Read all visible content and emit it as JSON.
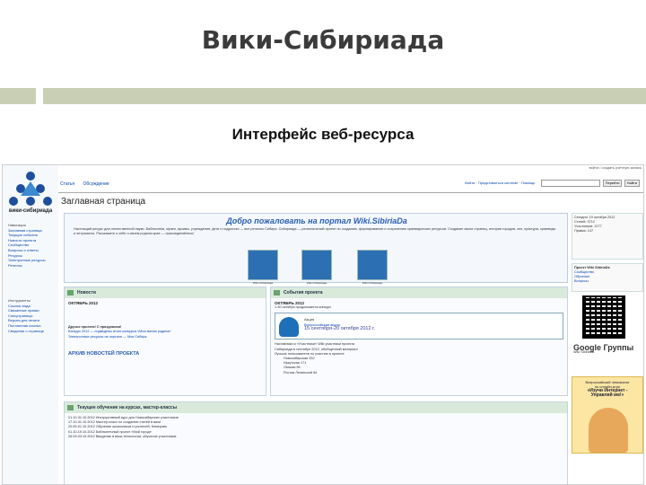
{
  "slide": {
    "title": "Вики-Сибириада",
    "subtitle": "Интерфейс веб-ресурса"
  },
  "colors": {
    "accent_bar": "#c9cfb4",
    "link": "#0645ad",
    "panel_head": "#d9eadb",
    "welcome_title": "#2a5db0"
  },
  "wiki": {
    "sidebar": {
      "logo_text": "вики-сибириада",
      "nav_head": "Навигация",
      "nav_items": [
        "Заглавная страница",
        "Текущие события",
        "Новости проекта",
        "Сообщество",
        "Вопросы и ответы",
        "Ресурсы",
        "Электронные ресурсы",
        "Регионы"
      ],
      "tools_head": "Инструменты",
      "tool_items": [
        "Ссылки сюда",
        "Связанные правки",
        "Спецстраницы",
        "Версия для печати",
        "Постоянная ссылка",
        "Сведения о странице"
      ]
    },
    "tabs": [
      "Статья",
      "Обсуждение"
    ],
    "search": {
      "links": [
        "Войти",
        "Представиться системе",
        "Помощь"
      ],
      "buttons": [
        "Перейти",
        "Найти"
      ]
    },
    "page_heading": "Заглавная страница",
    "welcome": {
      "title": "Добро пожаловать на портал Wiki.SibiriaDa",
      "text": "Настоящий ресурс для отечественной науки. Библиотеки, музеи, архивы, учреждения, дети и подростки — все регионы Сибири. Сибириада — региональный проект по созданию, формированию и сохранению краеведческих ресурсов. Создание своих страниц, истории городов, сел, культуры, краеведы и энтузиасты. Расскажите о себе и своем родном крае — присоединяйтесь!",
      "emblems": [
        "Wiki Сибириада",
        "Wiki Сибириада",
        "Wiki Сибириада"
      ]
    },
    "news_panel": {
      "head": "Новости",
      "month": "ОКТЯБРЬ 2012",
      "items": [
        "Друзья проекта! С праздником!",
        "Конкурс 2012 — подведены итоги конкурса «Моя малая родина»",
        "Электронные ресурсы на портале — Моя Сибирь"
      ],
      "archive": "АРХИВ НОВОСТЕЙ ПРОЕКТА"
    },
    "events_panel": {
      "head": "События проекта",
      "month": "ОКТЯБРЬ 2012",
      "first": "1-30 октября продолжается конкурс",
      "event_title": "Акция",
      "event_sub": "Всероссийская акция",
      "event_date": "15 сентября-20 октября 2012 г.",
      "items": [
        "Наставники и «Участники» Wiki участники проекта",
        "Сибириада в сентябре 2012, обобщенный материал",
        "Лучшие пользователи по участию в проекте",
        "Новосибирская 252",
        "Иркутская 171",
        "Омская 96",
        "Ростов Ленинской 64"
      ]
    },
    "learning_panel": {
      "head": "Текущее обучение на курсах, мастер-классы",
      "items": [
        "21.10-31.10.2012 Инструктивный курс для Новосибирских участников",
        "17.10-31.10.2012 Мастер-класс по созданию статей в вики",
        "20.09-01.10.2012 Обучение школьников и учителей, Кемерово",
        "01.10-19.10.2012 Библиотечный проект «Мой город»",
        "26.09-03.10.2012 Введение в вики-технологии, обучение участников"
      ]
    },
    "right_col": {
      "top_lines": [
        "Сегодня: 19 октября 2012",
        "Статей: 3712",
        "Участников: 1277",
        "Правок: 147"
      ],
      "project_head": "Проект Wiki SibiriaDa",
      "project_lines": [
        "Сообщество",
        "Обучение",
        "Вопросы"
      ],
      "google_label": "Google Группы",
      "group_name": "Wiki Sibiriada",
      "ad_lines": [
        "Всероссийский чемпионат",
        "по онлайн-игре",
        "«Изучи Интернет -",
        "Управляй им!»"
      ]
    },
    "topline": "войти / создать учётную запись"
  }
}
